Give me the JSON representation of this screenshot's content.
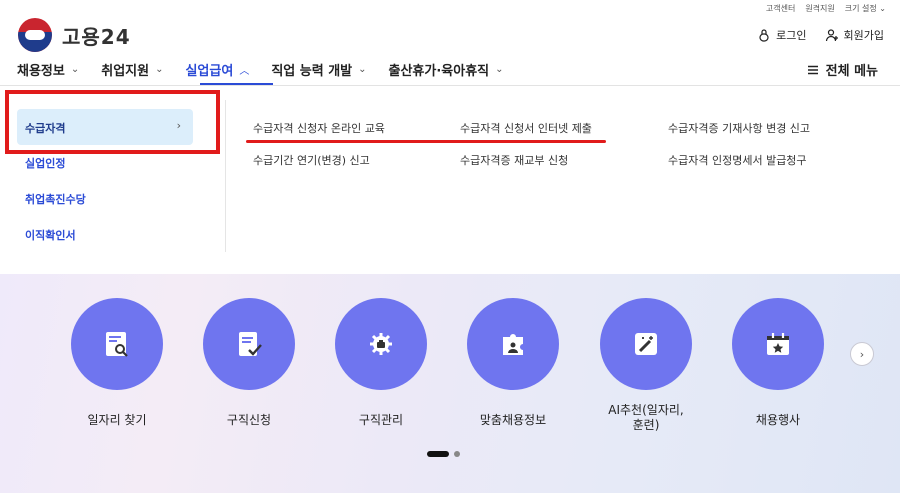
{
  "header": {
    "logo_text": "고용24",
    "util_links": [
      "고객센터",
      "원격지원",
      "크기 설정 ⌄"
    ],
    "login": "로그인",
    "signup": "회원가입"
  },
  "nav": {
    "items": [
      {
        "label": "채용정보",
        "chev": "⌄"
      },
      {
        "label": "취업지원",
        "chev": "⌄"
      },
      {
        "label": "실업급여",
        "chev": "︿"
      },
      {
        "label": "직업 능력 개발",
        "chev": "⌄"
      },
      {
        "label": "출산휴가·육아휴직",
        "chev": "⌄"
      }
    ],
    "all_menu": "전체 메뉴"
  },
  "submenu": {
    "items": [
      "수급자격",
      "실업인정",
      "취업촉진수당",
      "이직확인서"
    ],
    "arrow": "›"
  },
  "links": {
    "row1": [
      "수급자격 신청자 온라인 교육",
      "수급자격 신청서 인터넷 제출",
      "수급자격증 기재사항 변경 신고"
    ],
    "row2": [
      "수급기간 연기(변경) 신고",
      "수급자격증 재교부 신청",
      "수급자격 인정명세서 발급청구"
    ]
  },
  "quick_menu": {
    "items": [
      {
        "label": "일자리 찾기",
        "icon": "search-document-icon"
      },
      {
        "label": "구직신청",
        "icon": "checklist-icon"
      },
      {
        "label": "구직관리",
        "icon": "gear-briefcase-icon"
      },
      {
        "label": "맞춤채용정보",
        "icon": "puzzle-person-icon"
      },
      {
        "label": "AI추천(일자리,\n훈련)",
        "icon": "magic-wand-icon"
      },
      {
        "label": "채용행사",
        "icon": "calendar-star-icon"
      }
    ],
    "next": "›"
  },
  "colors": {
    "accent": "#2b4bd6",
    "quick_circle": "#6f75ef",
    "highlight": "#e11b1b",
    "submenu_selected_bg": "#dceefb"
  }
}
